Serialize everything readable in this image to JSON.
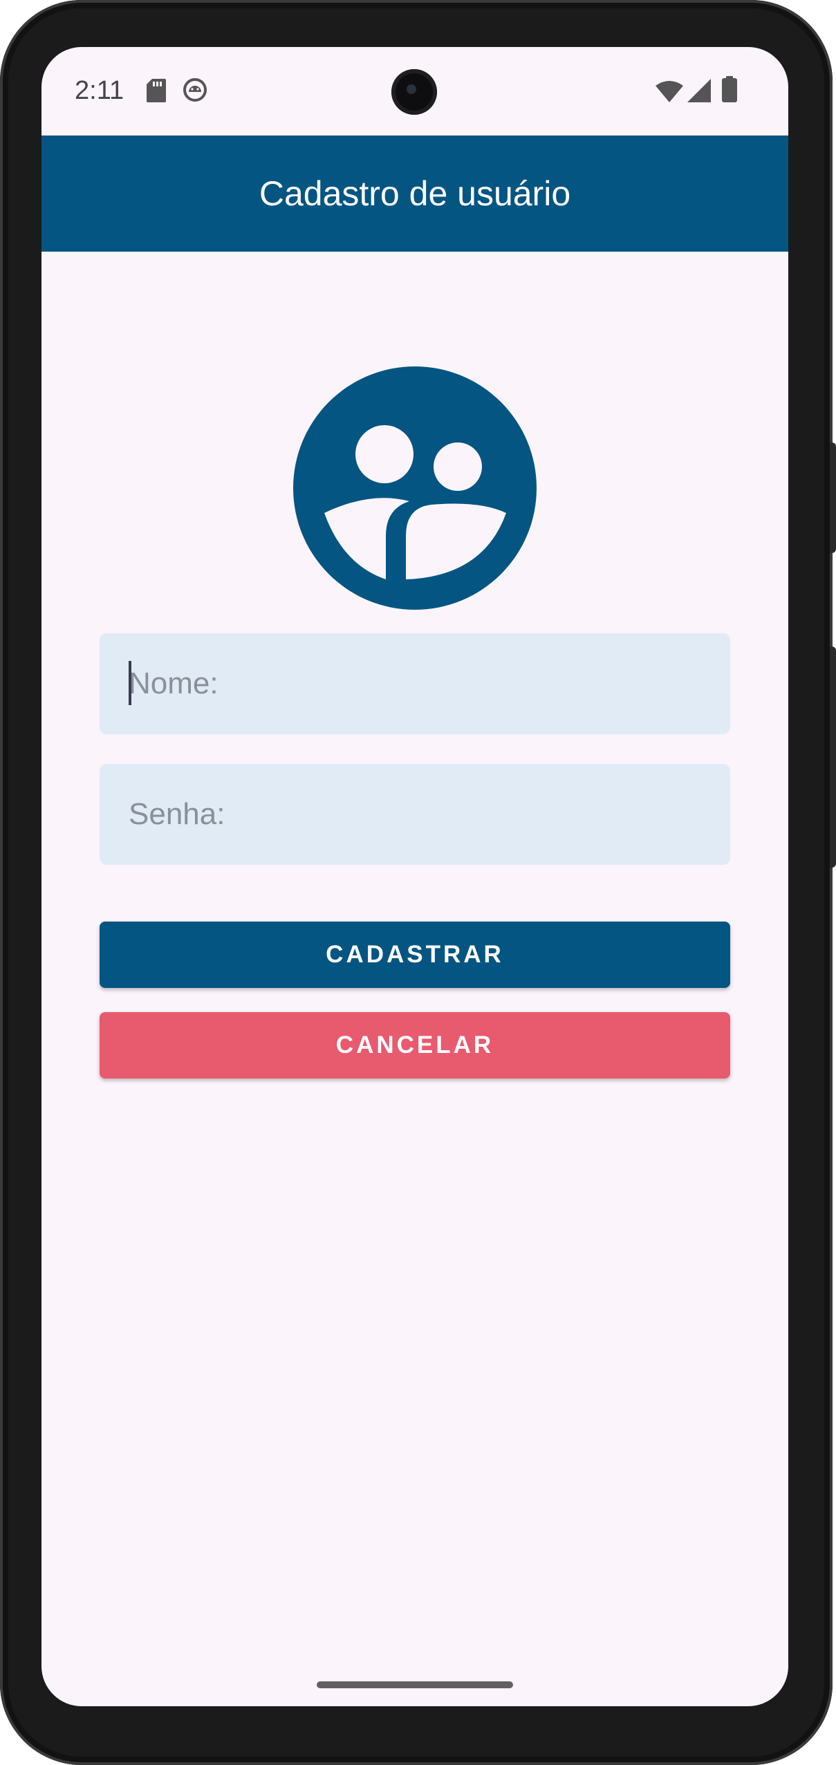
{
  "status_bar": {
    "time": "2:11",
    "left_icons": [
      "sd-card-icon",
      "android-debug-icon"
    ],
    "right_icons": [
      "wifi-icon",
      "cell-signal-icon",
      "battery-icon"
    ]
  },
  "app_bar": {
    "title": "Cadastro de usuário"
  },
  "avatar": {
    "icon": "group-avatar-icon"
  },
  "form": {
    "name_field": {
      "placeholder": "Nome:",
      "value": ""
    },
    "password_field": {
      "placeholder": "Senha:",
      "value": ""
    },
    "submit_label": "CADASTRAR",
    "cancel_label": "CANCELAR"
  },
  "colors": {
    "primary": "#045582",
    "danger": "#e85a6d",
    "field_bg": "#e1ebf5",
    "screen_bg": "#fbf4fb"
  }
}
